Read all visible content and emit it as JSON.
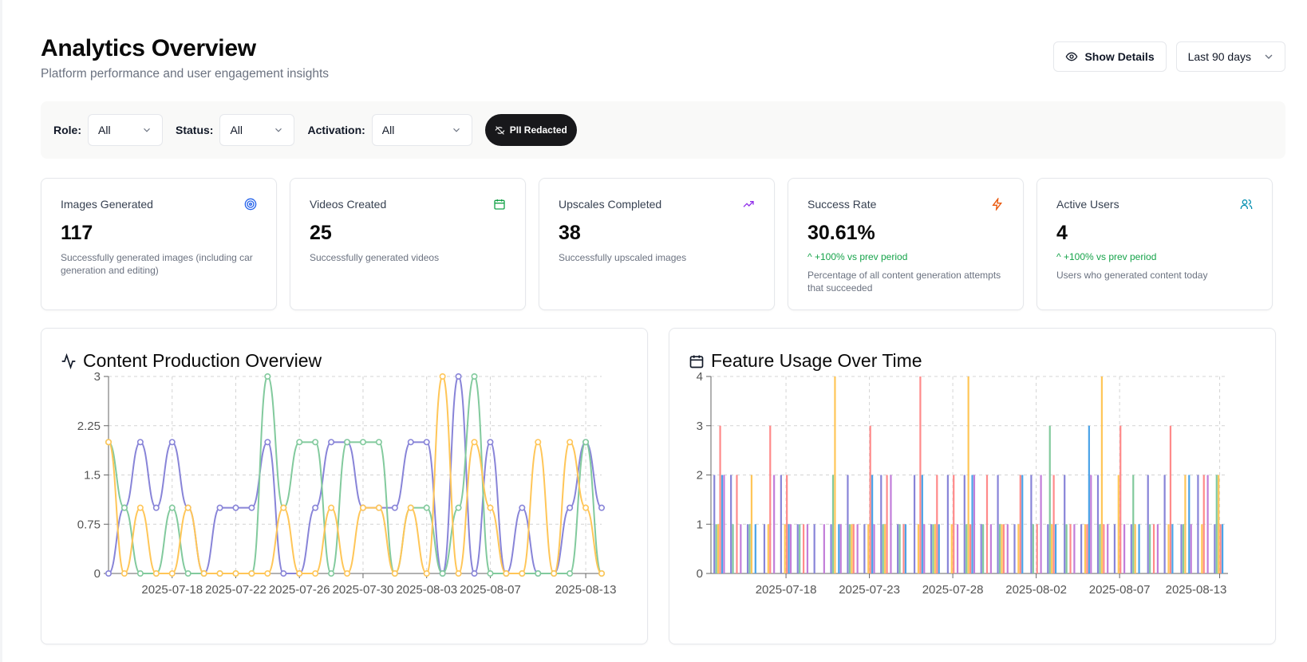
{
  "header": {
    "title": "Analytics Overview",
    "subtitle": "Platform performance and user engagement insights",
    "show_details_label": "Show Details",
    "range_label": "Last 90 days"
  },
  "filters": {
    "role_label": "Role:",
    "role_value": "All",
    "status_label": "Status:",
    "status_value": "All",
    "activation_label": "Activation:",
    "activation_value": "All",
    "pii_label": "PII Redacted"
  },
  "stats": [
    {
      "title": "Images Generated",
      "value": "117",
      "trend": "",
      "desc": "Successfully generated images (including car generation and editing)",
      "icon": "target-icon",
      "color": "#2563eb"
    },
    {
      "title": "Videos Created",
      "value": "25",
      "trend": "",
      "desc": "Successfully generated videos",
      "icon": "calendar-icon",
      "color": "#16a34a"
    },
    {
      "title": "Upscales Completed",
      "value": "38",
      "trend": "",
      "desc": "Successfully upscaled images",
      "icon": "trending-up-icon",
      "color": "#9333ea"
    },
    {
      "title": "Success Rate",
      "value": "30.61%",
      "trend": "^ +100% vs prev period",
      "desc": "Percentage of all content generation attempts that succeeded",
      "icon": "zap-icon",
      "color": "#ea580c"
    },
    {
      "title": "Active Users",
      "value": "4",
      "trend": "^ +100% vs prev period",
      "desc": "Users who generated content today",
      "icon": "users-icon",
      "color": "#0891b2"
    }
  ],
  "panels": {
    "left_title": "Content Production Overview",
    "right_title": "Feature Usage Over Time"
  },
  "chart_data": [
    {
      "type": "line",
      "title": "Content Production Overview",
      "start_date": "2025-07-14",
      "ylim": [
        0,
        3
      ],
      "yticks": [
        "0",
        "0.75",
        "1.5",
        "2.25",
        "3"
      ],
      "xticks": [
        "2025-07-18",
        "2025-07-22",
        "2025-07-26",
        "2025-07-30",
        "2025-08-03",
        "2025-08-07",
        "2025-08-13"
      ],
      "x_start_date": "2025-07-14",
      "x_end_date": "2025-08-13",
      "grid": true,
      "series": [
        {
          "color": "#8884d8",
          "values": [
            0,
            1,
            2,
            1,
            2,
            1,
            0,
            1,
            1,
            1,
            2,
            0,
            0,
            1,
            2,
            2,
            1,
            1,
            1,
            2,
            2,
            0,
            3,
            0,
            2,
            0,
            1,
            0,
            0,
            1,
            2,
            1
          ]
        },
        {
          "color": "#82ca9d",
          "values": [
            2,
            1,
            0,
            0,
            1,
            0,
            0,
            0,
            0,
            0,
            3,
            1,
            2,
            2,
            0,
            2,
            2,
            2,
            0,
            1,
            1,
            0,
            1,
            3,
            0,
            0,
            0,
            0,
            0,
            0,
            2,
            0
          ]
        },
        {
          "color": "#ffc658",
          "values": [
            2,
            0,
            1,
            0,
            0,
            1,
            0,
            0,
            0,
            0,
            0,
            1,
            0,
            0,
            1,
            0,
            1,
            1,
            0,
            1,
            0,
            3,
            0,
            2,
            1,
            0,
            0,
            2,
            0,
            2,
            1,
            0
          ]
        }
      ]
    },
    {
      "type": "bar",
      "title": "Feature Usage Over Time",
      "ylim": [
        0,
        4
      ],
      "yticks": [
        "0",
        "1",
        "2",
        "3",
        "4"
      ],
      "xticks": [
        "2025-07-18",
        "2025-07-23",
        "2025-07-28",
        "2025-08-02",
        "2025-08-07",
        "2025-08-13"
      ],
      "grid": true,
      "series_colors": [
        "#8884d8",
        "#82ca9d",
        "#ffc658",
        "#ff8a8a",
        "#4ba3e8",
        "#c27dd9"
      ],
      "days": [
        [
          2,
          1,
          1,
          3,
          2,
          2
        ],
        [
          2,
          1,
          0,
          2,
          0,
          1
        ],
        [
          1,
          1,
          2,
          0,
          1,
          0
        ],
        [
          1,
          0,
          1,
          3,
          0,
          2
        ],
        [
          2,
          0,
          1,
          2,
          1,
          1
        ],
        [
          1,
          1,
          0,
          1,
          0,
          1
        ],
        [
          1,
          0,
          0,
          0,
          0,
          1
        ],
        [
          1,
          2,
          4,
          0,
          1,
          1
        ],
        [
          2,
          1,
          1,
          1,
          0,
          1
        ],
        [
          1,
          0,
          1,
          3,
          2,
          1
        ],
        [
          2,
          1,
          1,
          2,
          0,
          2
        ],
        [
          1,
          1,
          0,
          1,
          1,
          0
        ],
        [
          2,
          0,
          1,
          4,
          2,
          1
        ],
        [
          1,
          1,
          1,
          2,
          1,
          0
        ],
        [
          2,
          0,
          1,
          2,
          0,
          1
        ],
        [
          2,
          1,
          4,
          1,
          2,
          2
        ],
        [
          1,
          1,
          0,
          2,
          0,
          1
        ],
        [
          2,
          1,
          1,
          1,
          0,
          1
        ],
        [
          1,
          0,
          1,
          2,
          2,
          0
        ],
        [
          2,
          1,
          0,
          1,
          0,
          2
        ],
        [
          1,
          3,
          1,
          2,
          1,
          0
        ],
        [
          2,
          1,
          0,
          1,
          0,
          1
        ],
        [
          1,
          0,
          1,
          1,
          3,
          2
        ],
        [
          2,
          1,
          4,
          1,
          0,
          1
        ],
        [
          1,
          0,
          2,
          3,
          0,
          1
        ],
        [
          1,
          2,
          1,
          0,
          1,
          0
        ],
        [
          2,
          1,
          0,
          1,
          0,
          1
        ],
        [
          2,
          0,
          1,
          3,
          1,
          0
        ],
        [
          1,
          1,
          2,
          0,
          2,
          1
        ],
        [
          2,
          0,
          1,
          2,
          0,
          2
        ],
        [
          1,
          2,
          2,
          1,
          1,
          0
        ]
      ]
    }
  ]
}
